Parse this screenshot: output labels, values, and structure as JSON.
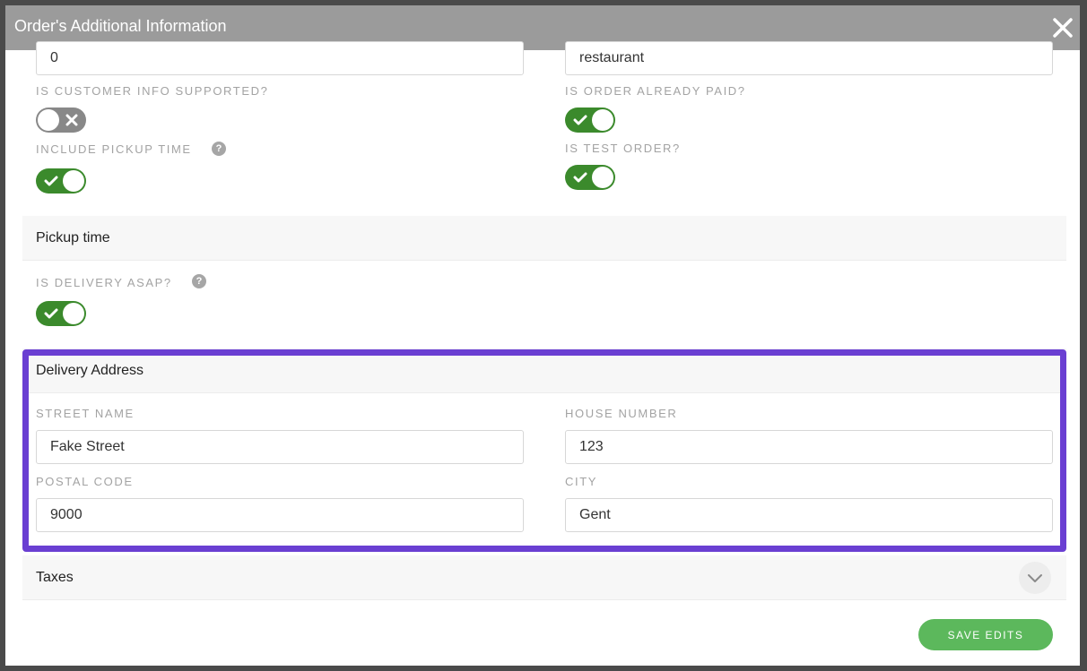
{
  "modal": {
    "title": "Order's Additional Information"
  },
  "fields": {
    "top_left_value": "0",
    "top_right_value": "restaurant"
  },
  "toggles": {
    "customer_info": {
      "label": "IS CUSTOMER INFO SUPPORTED?",
      "state": "off"
    },
    "order_paid": {
      "label": "IS ORDER ALREADY PAID?",
      "state": "on"
    },
    "pickup_time": {
      "label": "INCLUDE PICKUP TIME",
      "state": "on",
      "help": "?"
    },
    "test_order": {
      "label": "IS TEST ORDER?",
      "state": "on"
    },
    "delivery_asap": {
      "label": "IS DELIVERY ASAP?",
      "state": "on",
      "help": "?"
    }
  },
  "sections": {
    "pickup": {
      "title": "Pickup time"
    },
    "delivery": {
      "title": "Delivery Address"
    },
    "taxes": {
      "title": "Taxes"
    }
  },
  "address": {
    "street_label": "STREET NAME",
    "street_value": "Fake Street",
    "house_label": "HOUSE NUMBER",
    "house_value": "123",
    "postal_label": "POSTAL CODE",
    "postal_value": "9000",
    "city_label": "CITY",
    "city_value": "Gent"
  },
  "actions": {
    "save_label": "SAVE EDITS"
  },
  "colors": {
    "header": "#9b9b9b",
    "toggle_on": "#3b8a2c",
    "toggle_off": "#888888",
    "highlight": "#6a3fd2",
    "save_button": "#5cb85c"
  },
  "icons": {
    "close": "close-icon",
    "check": "checkmark-icon",
    "cross": "cross-icon",
    "chevron": "chevron-down-icon",
    "help": "help-icon"
  }
}
